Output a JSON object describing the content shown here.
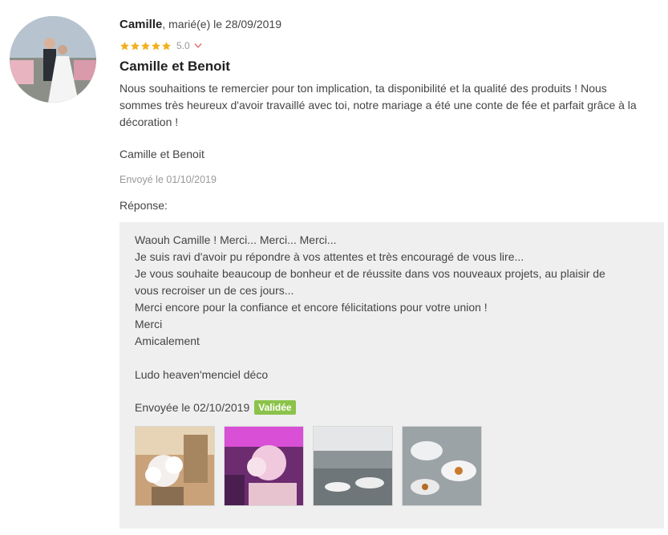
{
  "review": {
    "author": "Camille",
    "meta": ", marié(e) le 28/09/2019",
    "rating": 5.0,
    "rating_text": "5.0",
    "title": "Camille et Benoit",
    "body": "Nous souhaitions te remercier pour ton implication, ta disponibilité et la qualité des produits ! Nous sommes très heureux d'avoir travaillé avec toi, notre mariage a été une conte de fée et parfait grâce à la décoration !",
    "signature": "Camille et Benoit",
    "sent": "Envoyé le 01/10/2019",
    "response_label": "Réponse:"
  },
  "reply": {
    "lines": [
      "Waouh Camille ! Merci... Merci... Merci...",
      "Je suis ravi d'avoir pu répondre à vos attentes et très encouragé de vous lire...",
      "Je vous souhaite beaucoup de bonheur et de réussite dans vos nouveaux projets, au plaisir de vous recroiser un de ces jours...",
      "Merci encore pour la confiance et encore félicitations pour votre union !",
      "Merci",
      "Amicalement",
      "",
      "Ludo heaven'menciel déco"
    ],
    "sent": "Envoyée le 02/10/2019",
    "badge": "Validée"
  },
  "colors": {
    "star": "#f2b01e",
    "badge": "#8bc34a",
    "reply_bg": "#efefef"
  },
  "icons": {
    "star": "star-icon",
    "chevron": "chevron-down-icon"
  }
}
